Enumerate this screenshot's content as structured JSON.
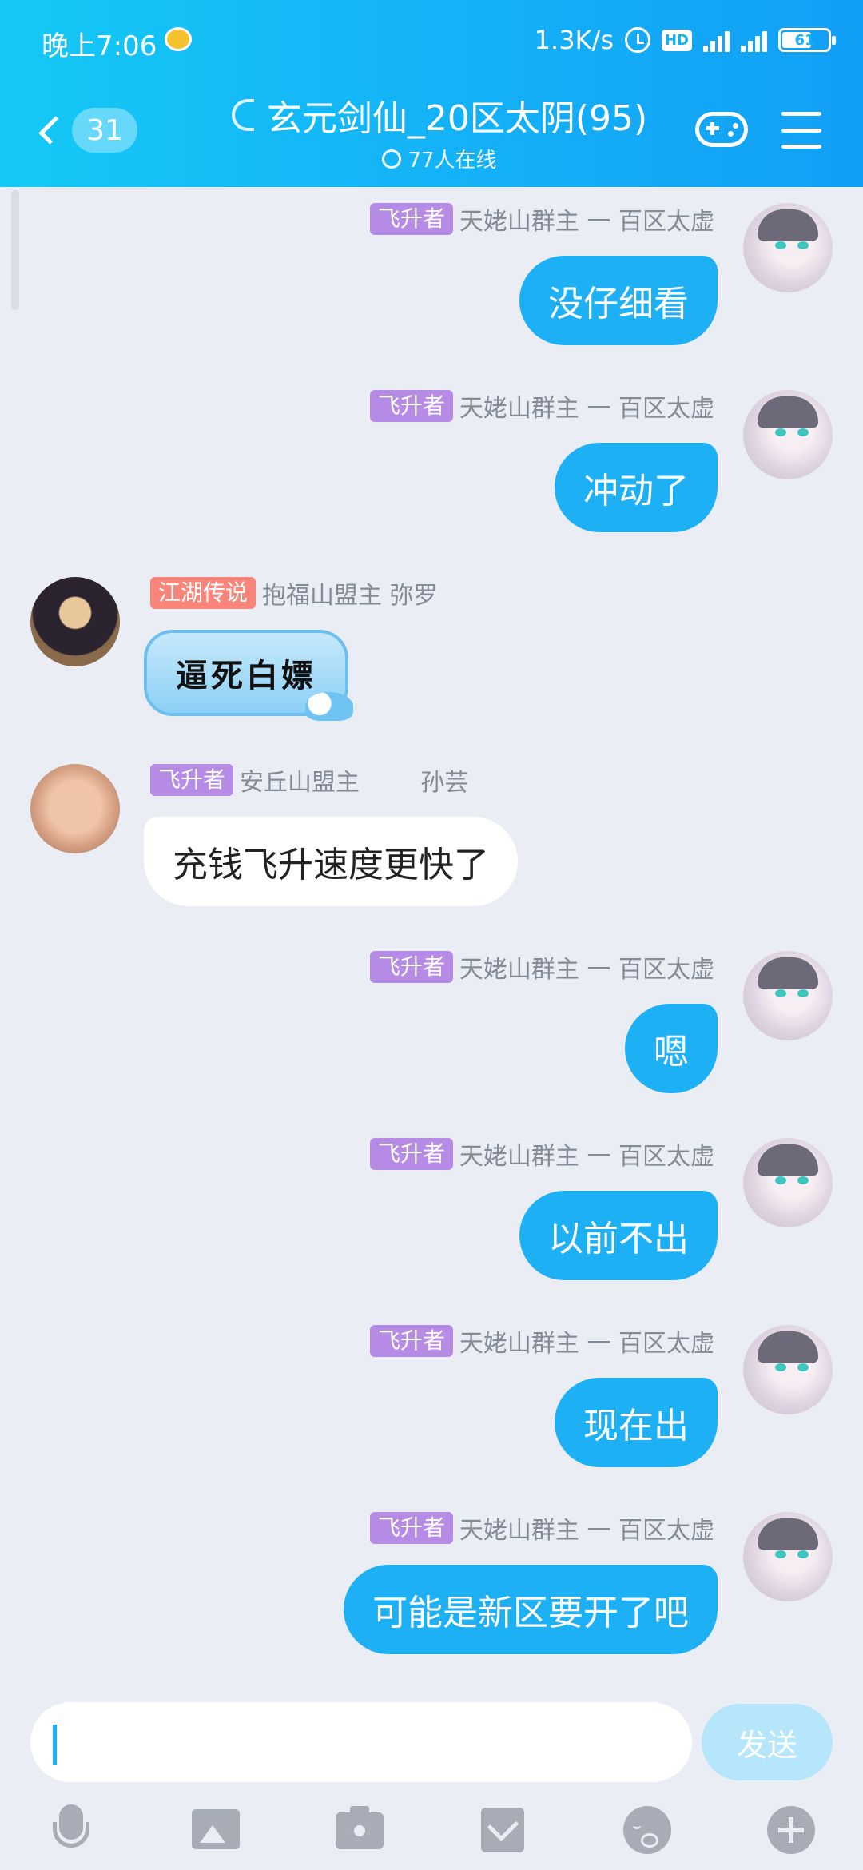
{
  "status_bar": {
    "time": "晚上7:06",
    "speed": "1.3K/s",
    "hd": "HD",
    "battery": "61"
  },
  "header": {
    "unread_count": "31",
    "title": "玄元剑仙_20区太阴(95)",
    "online": "77人在线"
  },
  "messages": [
    {
      "side": "out",
      "badge": "飞升者",
      "sender": "天姥山群主 一 百区太虚",
      "text": "没仔细看"
    },
    {
      "side": "out",
      "badge": "飞升者",
      "sender": "天姥山群主 一 百区太虚",
      "text": "冲动了"
    },
    {
      "side": "in",
      "badge": "江湖传说",
      "sender": "抱福山盟主  弥罗",
      "text": "逼死白嫖"
    },
    {
      "side": "in",
      "badge": "飞升者",
      "sender": "安丘山盟主        孙芸",
      "text": "充钱飞升速度更快了"
    },
    {
      "side": "out",
      "badge": "飞升者",
      "sender": "天姥山群主 一 百区太虚",
      "text": "嗯"
    },
    {
      "side": "out",
      "badge": "飞升者",
      "sender": "天姥山群主 一 百区太虚",
      "text": "以前不出"
    },
    {
      "side": "out",
      "badge": "飞升者",
      "sender": "天姥山群主 一 百区太虚",
      "text": "现在出"
    },
    {
      "side": "out",
      "badge": "飞升者",
      "sender": "天姥山群主 一 百区太虚",
      "text": "可能是新区要开了吧"
    }
  ],
  "input": {
    "value": "",
    "send_label": "发送"
  },
  "toolbar_icons": [
    "mic-icon",
    "image-icon",
    "camera-icon",
    "red-packet-icon",
    "emoji-icon",
    "plus-icon"
  ],
  "colors": {
    "header_start": "#14c9f6",
    "header_end": "#129ff6",
    "bubble_out": "#1db0f5",
    "badge_purple": "#b58be6",
    "badge_coral": "#f7857a"
  }
}
